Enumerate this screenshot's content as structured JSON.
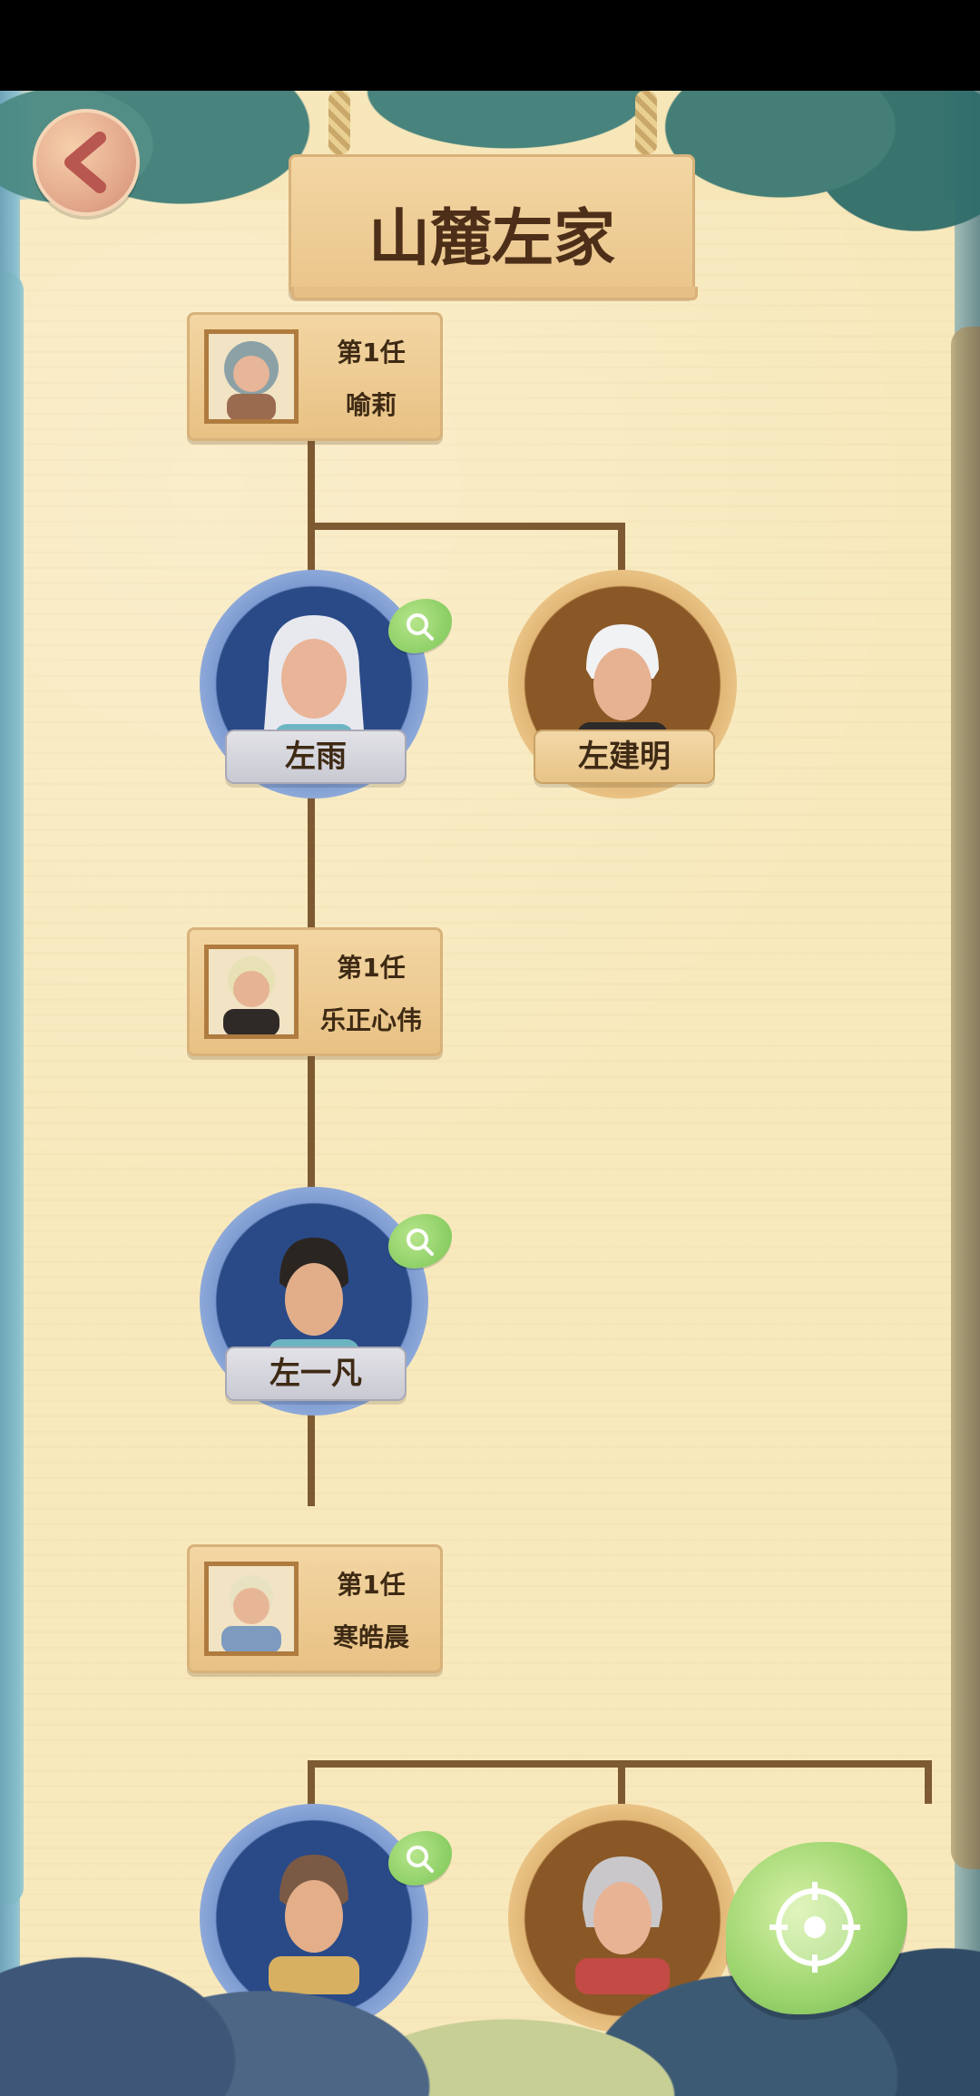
{
  "page": {
    "title": "山麓左家"
  },
  "buttons": {
    "back_icon": "chevron-left-icon",
    "locate_icon": "target-icon"
  },
  "tree": {
    "spouses": [
      {
        "generation_label": "第1任",
        "name": "喻莉"
      },
      {
        "generation_label": "第1任",
        "name": "乐正心伟"
      },
      {
        "generation_label": "第1任",
        "name": "寒皓晨"
      }
    ],
    "members": [
      {
        "name": "左雨",
        "frame": "blue",
        "has_search": true
      },
      {
        "name": "左建明",
        "frame": "tan",
        "has_search": false
      },
      {
        "name": "左一凡",
        "frame": "blue",
        "has_search": true
      },
      {
        "name": "",
        "frame": "blue",
        "has_search": true
      },
      {
        "name": "",
        "frame": "tan",
        "has_search": false
      }
    ]
  },
  "colors": {
    "tree_line": "#7d5a32",
    "title_text": "#4d2f19",
    "blue_frame": "#7d9bd1",
    "tan_frame": "#e2b777",
    "leaf_green": "#79c553"
  }
}
